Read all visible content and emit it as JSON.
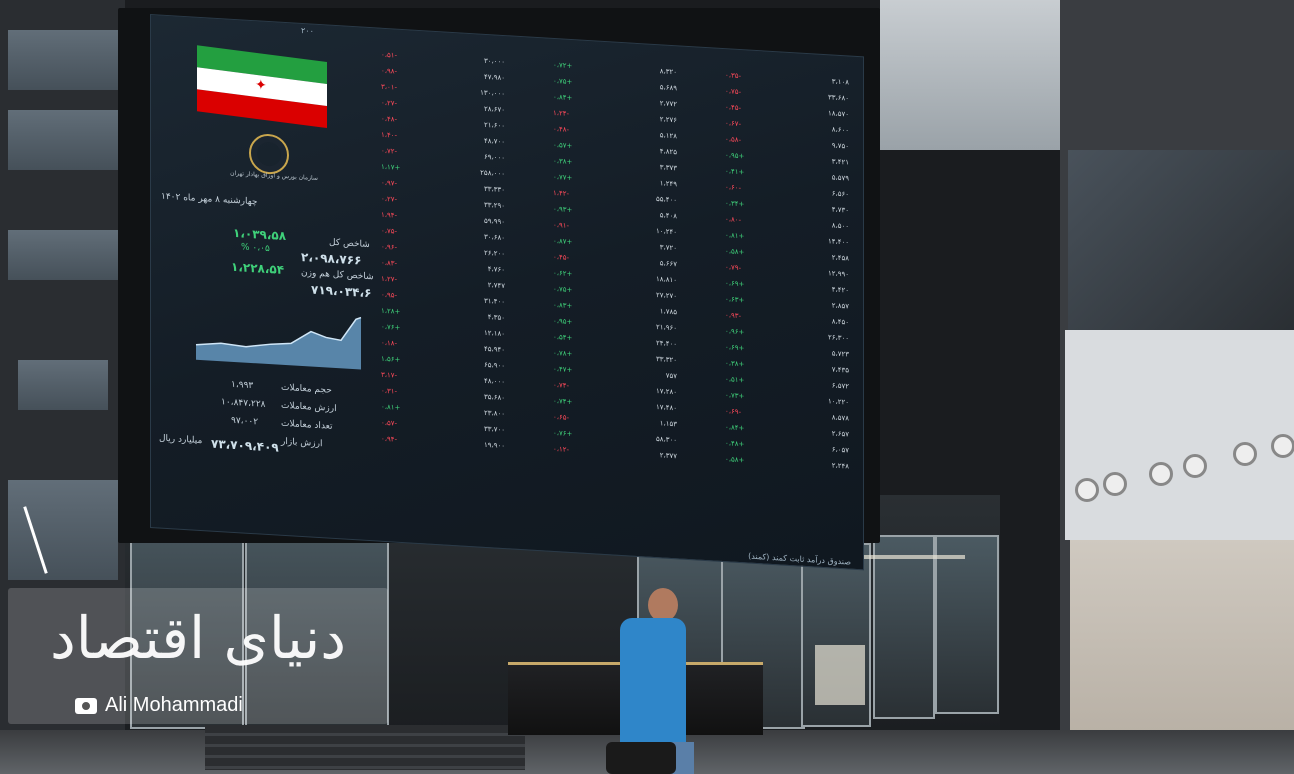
{
  "photo_credit": "Ali Mohammadi",
  "watermark_brand": "دنیای اقتصاد",
  "board": {
    "header_left": "۲۰۰",
    "header_date": "چهارشنبه ۸ مهر ماه ۱۴۰۲",
    "org_name": "سازمان بورس و اوراق بهادار تهران",
    "index_value": "۲،۰۹۸،۷۶۶",
    "index_label": "شاخص کل",
    "index_change": "۱،۰۳۹،۵۸",
    "index_change_pct": "۰،۰۵ %",
    "eq_index_value": "۷۱۹،۰۳۴،۶",
    "eq_index_label": "شاخص کل هم وزن",
    "eq_change": "۱،۲۲۸،۵۴",
    "volume_label": "حجم معاملات",
    "volume_value": "۱،۹۹۳",
    "value_label": "ارزش معاملات",
    "value_value": "۱۰،۸۴۷،۲۲۸",
    "count_label": "تعداد معاملات",
    "count_value": "۹۷،۰۰۲",
    "market_value_label": "ارزش بازار",
    "market_value": "۷۳،۷۰۹،۴۰۹",
    "unit_label": "میلیارد ریال",
    "footer_text": "صندوق درآمد ثابت کمند (کمند)"
  },
  "columns": [
    [
      {
        "name": "۳۰،۰۰۰",
        "chg": "-۰،۵۱",
        "dir": "dn"
      },
      {
        "name": "۴۷،۹۸۰",
        "chg": "-۰،۹۸",
        "dir": "dn"
      },
      {
        "name": "۱۳۰،۰۰۰",
        "chg": "-۳،۰۱",
        "dir": "dn"
      },
      {
        "name": "۲۸،۶۷۰",
        "chg": "-۰،۲۷",
        "dir": "dn"
      },
      {
        "name": "۲۱،۶۰۰",
        "chg": "-۰،۴۸",
        "dir": "dn"
      },
      {
        "name": "۴۸،۷۰۰",
        "chg": "-۱،۴۰",
        "dir": "dn"
      },
      {
        "name": "۶۹،۰۰۰",
        "chg": "-۰،۷۲",
        "dir": "dn"
      },
      {
        "name": "۲۵۸،۰۰۰",
        "chg": "+۱،۱۷",
        "dir": "up"
      },
      {
        "name": "۳۳،۳۳۰",
        "chg": "-۰،۹۷",
        "dir": "dn"
      },
      {
        "name": "۳۳،۲۹۰",
        "chg": "-۰،۲۷",
        "dir": "dn"
      },
      {
        "name": "۵۹،۹۹۰",
        "chg": "-۱،۹۴",
        "dir": "dn"
      },
      {
        "name": "۳۰،۶۸۰",
        "chg": "-۰،۷۵",
        "dir": "dn"
      },
      {
        "name": "۲۶،۲۰۰",
        "chg": "-۰،۹۶",
        "dir": "dn"
      },
      {
        "name": "۴،۷۶۰",
        "chg": "-۰،۸۳",
        "dir": "dn"
      },
      {
        "name": "۲،۷۴۷",
        "chg": "-۱،۲۷",
        "dir": "dn"
      },
      {
        "name": "۳۱،۴۰۰",
        "chg": "-۰،۹۵",
        "dir": "dn"
      },
      {
        "name": "۴،۳۵۰",
        "chg": "+۱،۲۸",
        "dir": "up"
      },
      {
        "name": "۱۲،۱۸۰",
        "chg": "+۰،۷۶",
        "dir": "up"
      },
      {
        "name": "۴۵،۹۴۰",
        "chg": "-۰،۱۸",
        "dir": "dn"
      },
      {
        "name": "۶۵،۹۰۰",
        "chg": "+۱،۵۶",
        "dir": "up"
      },
      {
        "name": "۴۸،۰۰۰",
        "chg": "-۳،۱۷",
        "dir": "dn"
      },
      {
        "name": "۳۵،۶۸۰",
        "chg": "-۰،۳۱",
        "dir": "dn"
      },
      {
        "name": "۲۳،۸۰۰",
        "chg": "+۰،۸۱",
        "dir": "up"
      },
      {
        "name": "۳۳،۷۰۰",
        "chg": "-۰،۵۷",
        "dir": "dn"
      },
      {
        "name": "۱۹،۹۰۰",
        "chg": "-۰،۹۴",
        "dir": "dn"
      }
    ],
    [
      {
        "name": "۸،۳۲۰",
        "chg": "+۰،۷۲",
        "dir": "up"
      },
      {
        "name": "۵،۶۸۹",
        "chg": "+۰،۷۵",
        "dir": "up"
      },
      {
        "name": "۲،۷۷۲",
        "chg": "+۰،۸۴",
        "dir": "up"
      },
      {
        "name": "۲،۲۷۶",
        "chg": "-۱،۲۴",
        "dir": "dn"
      },
      {
        "name": "۵،۱۲۸",
        "chg": "-۰،۴۸",
        "dir": "dn"
      },
      {
        "name": "۴،۸۲۵",
        "chg": "+۰،۵۷",
        "dir": "up"
      },
      {
        "name": "۳،۳۷۳",
        "chg": "+۰،۳۸",
        "dir": "up"
      },
      {
        "name": "۱،۲۴۹",
        "chg": "+۰،۷۷",
        "dir": "up"
      },
      {
        "name": "۵۵،۴۰۰",
        "chg": "-۱،۴۲",
        "dir": "dn"
      },
      {
        "name": "۵،۴۰۸",
        "chg": "+۰،۹۳",
        "dir": "up"
      },
      {
        "name": "۱۰،۲۴۰",
        "chg": "-۰،۹۱",
        "dir": "dn"
      },
      {
        "name": "۳،۷۲۰",
        "chg": "+۰،۸۷",
        "dir": "up"
      },
      {
        "name": "۵،۶۶۷",
        "chg": "-۰،۴۵",
        "dir": "dn"
      },
      {
        "name": "۱۸،۸۱۰",
        "chg": "+۰،۶۲",
        "dir": "up"
      },
      {
        "name": "۲۷،۲۷۰",
        "chg": "+۰،۷۵",
        "dir": "up"
      },
      {
        "name": "۱،۷۸۵",
        "chg": "+۰،۸۳",
        "dir": "up"
      },
      {
        "name": "۲۱،۹۶۰",
        "chg": "+۰،۹۵",
        "dir": "up"
      },
      {
        "name": "۲۴،۴۰۰",
        "chg": "+۰،۵۴",
        "dir": "up"
      },
      {
        "name": "۳۳،۳۲۰",
        "chg": "+۰،۷۸",
        "dir": "up"
      },
      {
        "name": "۷۵۷",
        "chg": "+۰،۴۷",
        "dir": "up"
      },
      {
        "name": "۱۷،۲۸۰",
        "chg": "-۰،۷۴",
        "dir": "dn"
      },
      {
        "name": "۱۷،۴۸۰",
        "chg": "+۰،۷۴",
        "dir": "up"
      },
      {
        "name": "۱،۱۵۳",
        "chg": "-۰،۶۵",
        "dir": "dn"
      },
      {
        "name": "۵۸،۳۰۰",
        "chg": "+۰،۷۶",
        "dir": "up"
      },
      {
        "name": "۲،۳۷۷",
        "chg": "-۰،۱۲",
        "dir": "dn"
      }
    ],
    [
      {
        "name": "۳،۱۰۸",
        "chg": "-۰،۳۵",
        "dir": "dn"
      },
      {
        "name": "۳۳،۶۸۰",
        "chg": "-۰،۷۵",
        "dir": "dn"
      },
      {
        "name": "۱۸،۵۷۰",
        "chg": "-۰،۴۵",
        "dir": "dn"
      },
      {
        "name": "۸،۶۰۰",
        "chg": "-۰،۶۷",
        "dir": "dn"
      },
      {
        "name": "۹،۷۵۰",
        "chg": "-۰،۵۸",
        "dir": "dn"
      },
      {
        "name": "۳،۴۲۱",
        "chg": "+۰،۹۵",
        "dir": "up"
      },
      {
        "name": "۵،۵۷۹",
        "chg": "+۰،۴۱",
        "dir": "up"
      },
      {
        "name": "۶،۵۶۰",
        "chg": "-۰،۶۰",
        "dir": "dn"
      },
      {
        "name": "۴،۷۳۰",
        "chg": "+۰،۳۴",
        "dir": "up"
      },
      {
        "name": "۸،۵۰۰",
        "chg": "-۰،۸۰",
        "dir": "dn"
      },
      {
        "name": "۱۴،۴۰۰",
        "chg": "+۰،۸۱",
        "dir": "up"
      },
      {
        "name": "۲،۴۵۸",
        "chg": "+۰،۵۸",
        "dir": "up"
      },
      {
        "name": "۱۲،۹۹۰",
        "chg": "-۰،۷۹",
        "dir": "dn"
      },
      {
        "name": "۴،۴۲۰",
        "chg": "+۰،۶۹",
        "dir": "up"
      },
      {
        "name": "۲،۸۵۷",
        "chg": "+۰،۶۳",
        "dir": "up"
      },
      {
        "name": "۸،۴۵۰",
        "chg": "-۰،۹۳",
        "dir": "dn"
      },
      {
        "name": "۲۶،۳۰۰",
        "chg": "+۰،۹۶",
        "dir": "up"
      },
      {
        "name": "۵،۷۲۳",
        "chg": "+۰،۶۹",
        "dir": "up"
      },
      {
        "name": "۷،۴۳۵",
        "chg": "+۰،۳۸",
        "dir": "up"
      },
      {
        "name": "۶،۵۷۲",
        "chg": "+۰،۵۱",
        "dir": "up"
      },
      {
        "name": "۱۰،۲۲۰",
        "chg": "+۰،۷۳",
        "dir": "up"
      },
      {
        "name": "۸،۵۷۸",
        "chg": "-۰،۶۹",
        "dir": "dn"
      },
      {
        "name": "۲،۶۵۷",
        "chg": "+۰،۸۴",
        "dir": "up"
      },
      {
        "name": "۶،۰۵۷",
        "chg": "+۰،۴۸",
        "dir": "up"
      },
      {
        "name": "۲،۲۴۸",
        "chg": "+۰،۵۸",
        "dir": "up"
      }
    ]
  ],
  "colors": {
    "up": "#3fd17a",
    "down": "#ff4a5a",
    "board_bg": "#141d26",
    "flag_green": "#239f40",
    "flag_white": "#ffffff",
    "flag_red": "#da0000",
    "chart_fill": "#6fa8d6"
  }
}
